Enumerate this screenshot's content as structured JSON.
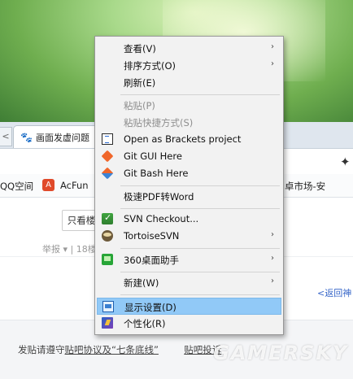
{
  "browser": {
    "tab_arrow": "<",
    "tab_title": "画面发虚问题",
    "bookmarks": [
      {
        "label": "QQ空间"
      },
      {
        "label": "AcFun",
        "icon_letter": "A"
      },
      {
        "label": "卓市场-安"
      }
    ],
    "only_lz_button": "只看楼",
    "report_text": "举报 ▾ | 18楼",
    "back_link": "<返回神",
    "notice_prefix": "发贴请遵守",
    "notice_link1": "贴吧协议及“七条底线”",
    "notice_link2": "贴吧投诉"
  },
  "watermark": "GAMERSKY",
  "context_menu": {
    "view": "查看(V)",
    "sort": "排序方式(O)",
    "refresh": "刷新(E)",
    "paste": "粘贴(P)",
    "paste_shortcut": "粘贴快捷方式(S)",
    "open_brackets": "Open as Brackets project",
    "git_gui": "Git GUI Here",
    "git_bash": "Git Bash Here",
    "pdf_word": "极速PDF转Word",
    "svn_checkout": "SVN Checkout...",
    "tortoise_svn": "TortoiseSVN",
    "desk360": "360桌面助手",
    "new": "新建(W)",
    "display": "显示设置(D)",
    "personalize": "个性化(R)",
    "submenu_arrow": "›"
  },
  "colors": {
    "menu_bg": "#f2f2f2",
    "menu_hover": "#91c9f7",
    "disabled_text": "#8e8e8e",
    "link_blue": "#3867c9"
  }
}
